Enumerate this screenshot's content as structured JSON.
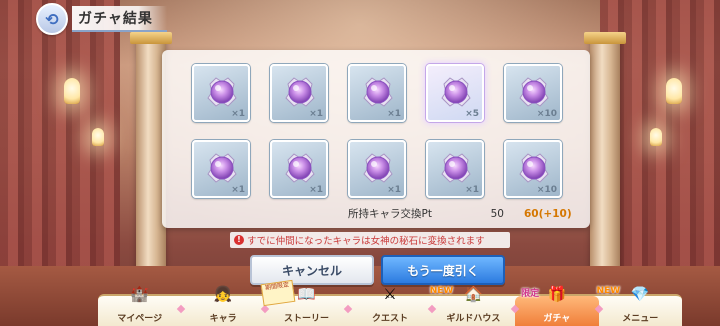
{
  "header": {
    "back_icon": "back-arrow-icon",
    "title": "ガチャ結果"
  },
  "results": {
    "items": [
      {
        "icon": "princess-orb-icon",
        "qty": "×1",
        "highlight": false
      },
      {
        "icon": "princess-orb-icon",
        "qty": "×1",
        "highlight": false
      },
      {
        "icon": "princess-orb-icon",
        "qty": "×1",
        "highlight": false
      },
      {
        "icon": "princess-orb-icon",
        "qty": "×5",
        "highlight": true
      },
      {
        "icon": "princess-orb-icon",
        "qty": "×10",
        "highlight": false
      },
      {
        "icon": "princess-orb-icon",
        "qty": "×1",
        "highlight": false
      },
      {
        "icon": "princess-orb-icon",
        "qty": "×1",
        "highlight": false
      },
      {
        "icon": "princess-orb-icon",
        "qty": "×1",
        "highlight": false
      },
      {
        "icon": "princess-orb-icon",
        "qty": "×1",
        "highlight": false
      },
      {
        "icon": "princess-orb-icon",
        "qty": "×10",
        "highlight": false
      }
    ],
    "points_label": "所持キャラ交換Pt",
    "points_value": "50",
    "points_new": "60(+10)"
  },
  "notice": "すでに仲間になったキャラは女神の秘石に変換されます",
  "buttons": {
    "cancel": "キャンセル",
    "draw_again": "もう一度引く"
  },
  "navbar": {
    "items": [
      {
        "label": "マイページ",
        "icon": "castle-icon",
        "glyph": "🏰",
        "new": "",
        "active": false
      },
      {
        "label": "キャラ",
        "icon": "character-icon",
        "glyph": "👧",
        "new": "",
        "active": false
      },
      {
        "label": "ストーリー",
        "icon": "book-icon",
        "glyph": "📖",
        "new": "",
        "active": false
      },
      {
        "label": "クエスト",
        "icon": "sword-icon",
        "glyph": "⚔",
        "new": "",
        "active": false
      },
      {
        "label": "ギルドハウス",
        "icon": "house-icon",
        "glyph": "🏠",
        "new": "NEW",
        "active": false
      },
      {
        "label": "ガチャ",
        "icon": "gacha-icon",
        "glyph": "🎁",
        "new": "",
        "active": true
      },
      {
        "label": "メニュー",
        "icon": "crystal-icon",
        "glyph": "💎",
        "new": "NEW",
        "active": false
      }
    ],
    "promo_text": "期間限定",
    "gacha_badge": "限定"
  },
  "colors": {
    "accent": "#2c7be0",
    "warning": "#c93a3a",
    "points_new": "#d57700"
  }
}
